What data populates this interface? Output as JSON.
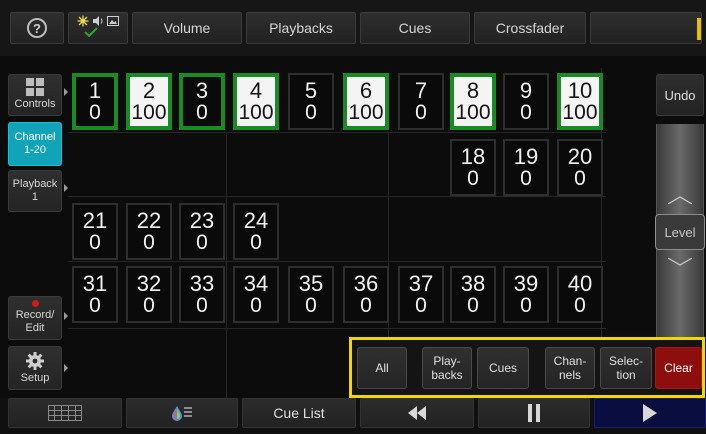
{
  "topbar": {
    "help_glyph": "?",
    "status_icons": [
      "brightness-icon",
      "speaker-icon",
      "image-icon",
      "checkmark-icon"
    ],
    "tabs": [
      {
        "label": "Volume"
      },
      {
        "label": "Playbacks"
      },
      {
        "label": "Cues"
      },
      {
        "label": "Crossfader"
      }
    ]
  },
  "sidebar": {
    "items": [
      {
        "label": "Controls",
        "icon": "grid-icon",
        "active": false
      },
      {
        "label": "Channel\n1-20",
        "active": true
      },
      {
        "label": "Playback\n1",
        "active": false
      },
      {
        "label": "Record/\nEdit",
        "icon": "record-dot-icon",
        "active": false
      },
      {
        "label": "Setup",
        "icon": "gear-icon",
        "active": false
      }
    ]
  },
  "channels": [
    {
      "ch": "1",
      "value": "0",
      "selected": true,
      "full": false
    },
    {
      "ch": "2",
      "value": "100",
      "selected": true,
      "full": true
    },
    {
      "ch": "3",
      "value": "0",
      "selected": true,
      "full": false
    },
    {
      "ch": "4",
      "value": "100",
      "selected": true,
      "full": true
    },
    {
      "ch": "5",
      "value": "0",
      "selected": false,
      "full": false
    },
    {
      "ch": "6",
      "value": "100",
      "selected": true,
      "full": true
    },
    {
      "ch": "7",
      "value": "0",
      "selected": false,
      "full": false
    },
    {
      "ch": "8",
      "value": "100",
      "selected": true,
      "full": true
    },
    {
      "ch": "9",
      "value": "0",
      "selected": false,
      "full": false
    },
    {
      "ch": "10",
      "value": "100",
      "selected": true,
      "full": true
    },
    {
      "ch": "18",
      "value": "0",
      "selected": false,
      "full": false
    },
    {
      "ch": "19",
      "value": "0",
      "selected": false,
      "full": false
    },
    {
      "ch": "20",
      "value": "0",
      "selected": false,
      "full": false
    },
    {
      "ch": "21",
      "value": "0",
      "selected": false,
      "full": false
    },
    {
      "ch": "22",
      "value": "0",
      "selected": false,
      "full": false
    },
    {
      "ch": "23",
      "value": "0",
      "selected": false,
      "full": false
    },
    {
      "ch": "24",
      "value": "0",
      "selected": false,
      "full": false
    },
    {
      "ch": "31",
      "value": "0",
      "selected": false,
      "full": false
    },
    {
      "ch": "32",
      "value": "0",
      "selected": false,
      "full": false
    },
    {
      "ch": "33",
      "value": "0",
      "selected": false,
      "full": false
    },
    {
      "ch": "34",
      "value": "0",
      "selected": false,
      "full": false
    },
    {
      "ch": "35",
      "value": "0",
      "selected": false,
      "full": false
    },
    {
      "ch": "36",
      "value": "0",
      "selected": false,
      "full": false
    },
    {
      "ch": "37",
      "value": "0",
      "selected": false,
      "full": false
    },
    {
      "ch": "38",
      "value": "0",
      "selected": false,
      "full": false
    },
    {
      "ch": "39",
      "value": "0",
      "selected": false,
      "full": false
    },
    {
      "ch": "40",
      "value": "0",
      "selected": false,
      "full": false
    }
  ],
  "rightpanel": {
    "undo_label": "Undo",
    "level_label": "Level"
  },
  "selection_bar": {
    "buttons": [
      {
        "label": "All"
      },
      {
        "label": "Play-\nbacks"
      },
      {
        "label": "Cues"
      },
      {
        "label": "Chan-\nnels"
      },
      {
        "label": "Selec-\ntion"
      },
      {
        "label": "Clear"
      }
    ]
  },
  "bottombar": {
    "cue_list_label": "Cue List",
    "icons": [
      "keypad-grid-icon",
      "color-effects-icon",
      "rewind-icon",
      "pause-icon",
      "play-icon"
    ]
  },
  "colors": {
    "accent_cyan": "#11a3b8",
    "selected_green": "#1a8a24",
    "highlight_yellow": "#f0d800",
    "clear_red": "#8e0d0d",
    "play_navy": "#0a0d40"
  }
}
